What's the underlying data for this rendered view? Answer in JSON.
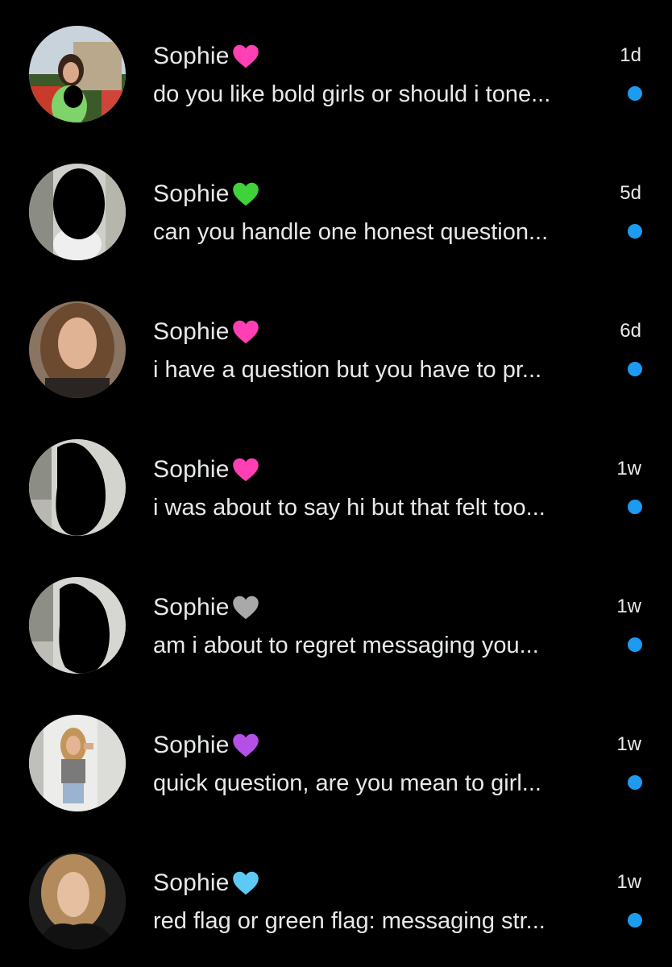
{
  "conversations": [
    {
      "name": "Sophie",
      "heart": "pink-heart",
      "heart_color": "#ff3fb4",
      "preview": "do you like bold girls or should i tone...",
      "time": "1d",
      "unread": true
    },
    {
      "name": "Sophie",
      "heart": "green-heart",
      "heart_color": "#3fd23a",
      "preview": "can you handle one honest question...",
      "time": "5d",
      "unread": true
    },
    {
      "name": "Sophie",
      "heart": "pink-heart",
      "heart_color": "#ff3fb4",
      "preview": "i have a question but you have to pr...",
      "time": "6d",
      "unread": true
    },
    {
      "name": "Sophie",
      "heart": "pink-heart",
      "heart_color": "#ff3fb4",
      "preview": "i was about to say hi but that felt too...",
      "time": "1w",
      "unread": true
    },
    {
      "name": "Sophie",
      "heart": "grey-heart",
      "heart_color": "#a9a9a9",
      "preview": "am i about to regret messaging you...",
      "time": "1w",
      "unread": true
    },
    {
      "name": "Sophie",
      "heart": "purple-heart",
      "heart_color": "#b44fe8",
      "preview": "quick question, are you mean to girl...",
      "time": "1w",
      "unread": true
    },
    {
      "name": "Sophie",
      "heart": "light-blue-heart",
      "heart_color": "#5ccaf5",
      "preview": "red flag or green flag: messaging str...",
      "time": "1w",
      "unread": true
    }
  ],
  "colors": {
    "background": "#000000",
    "text": "#e7e9ea",
    "unread_dot": "#1d9bf0"
  }
}
